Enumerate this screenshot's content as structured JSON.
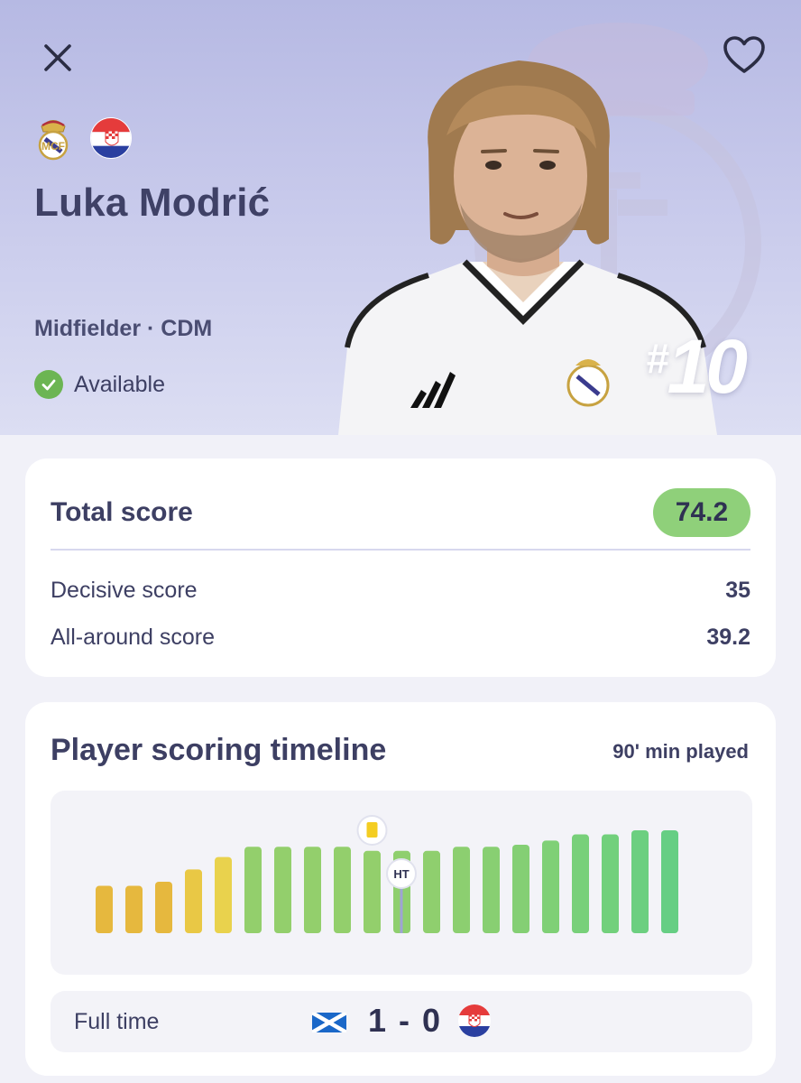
{
  "header": {
    "player_name": "Luka Modrić",
    "position": "Midfielder · CDM",
    "status": "Available",
    "shirt_hash": "#",
    "shirt_number": "10",
    "club_badge_icon": "real-madrid-crest",
    "nation_flag_icon": "croatia-flag",
    "colors": {
      "background": "#c3c6ea",
      "status_green": "#6cb553"
    }
  },
  "score": {
    "total_label": "Total score",
    "total_value": "74.2",
    "decisive_label": "Decisive score",
    "decisive_value": "35",
    "allaround_label": "All-around score",
    "allaround_value": "39.2",
    "total_badge_color": "#8fd07a"
  },
  "timeline": {
    "title": "Player scoring timeline",
    "minutes_played": "90' min played",
    "halftime_label": "HT",
    "event_icon": "yellow-card-icon",
    "bars": [
      {
        "level": 0.46,
        "color": "#e6b83e"
      },
      {
        "level": 0.46,
        "color": "#e6b83e"
      },
      {
        "level": 0.5,
        "color": "#e6b83e"
      },
      {
        "level": 0.62,
        "color": "#e9c845"
      },
      {
        "level": 0.74,
        "color": "#e9d24d"
      },
      {
        "level": 0.84,
        "color": "#93cf6c"
      },
      {
        "level": 0.84,
        "color": "#93cf6c"
      },
      {
        "level": 0.84,
        "color": "#93cf6c"
      },
      {
        "level": 0.84,
        "color": "#93cf6c"
      },
      {
        "level": 0.8,
        "color": "#93cf6c"
      },
      {
        "level": 0.8,
        "color": "#8fcf6e"
      },
      {
        "level": 0.8,
        "color": "#8fcf6e"
      },
      {
        "level": 0.84,
        "color": "#8ccf70"
      },
      {
        "level": 0.84,
        "color": "#88cf72"
      },
      {
        "level": 0.86,
        "color": "#84cf74"
      },
      {
        "level": 0.9,
        "color": "#7fd076"
      },
      {
        "level": 0.96,
        "color": "#78d07a"
      },
      {
        "level": 0.96,
        "color": "#72d07c"
      },
      {
        "level": 1.0,
        "color": "#6ccf80"
      },
      {
        "level": 1.0,
        "color": "#66ce84"
      }
    ],
    "yellow_card_after_bar": 10,
    "halftime_after_bar": 10,
    "result_label": "Full time",
    "home_flag_icon": "scotland-flag",
    "away_flag_icon": "croatia-flag",
    "score": "1 - 0"
  }
}
